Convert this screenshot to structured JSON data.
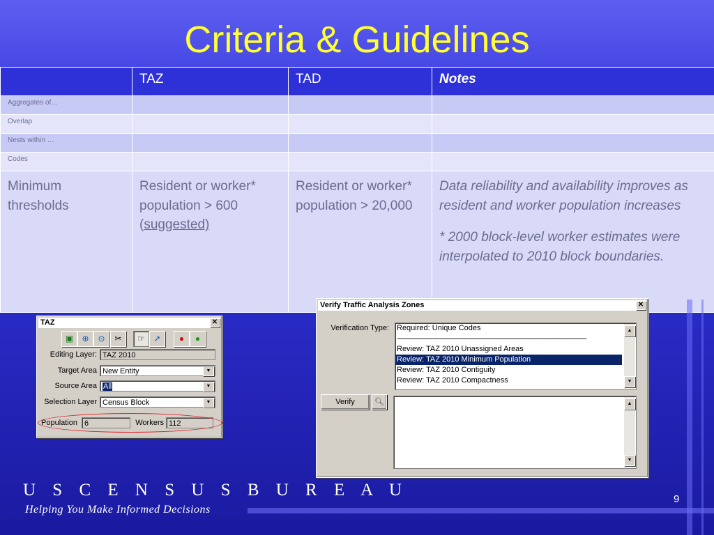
{
  "slide": {
    "title": "Criteria & Guidelines",
    "page_number": "9",
    "brand": "U S C E N S U S B U R E A U",
    "tagline": "Helping You Make Informed Decisions"
  },
  "criteria_table": {
    "headers": [
      "",
      "TAZ",
      "TAD",
      "Notes"
    ],
    "small_rows": [
      {
        "label": "Aggregates of…"
      },
      {
        "label": "Overlap"
      },
      {
        "label": "Nests within …"
      },
      {
        "label": "Codes"
      }
    ],
    "min_row": {
      "label": "Minimum thresholds",
      "taz_text": "Resident or worker* population > 600 (",
      "taz_suggested": "suggested)",
      "tad": "Resident or worker* population > 20,000",
      "notes_p1": " Data reliability and availability improves as resident and worker population increases",
      "notes_p2": "* 2000 block-level worker estimates were interpolated to 2010 block boundaries."
    }
  },
  "taz_window": {
    "title": "TAZ",
    "toolbar_icons": [
      "select-feature-icon",
      "zoom-in-icon",
      "zoom-extent-icon",
      "tools-icon",
      "edit-pointer-icon",
      "select-pointer-icon",
      "traffic-light-red-icon",
      "traffic-light-green-icon"
    ],
    "editing_layer_label": "Editing Layer:",
    "editing_layer_value": "TAZ 2010",
    "target_area_label": "Target Area",
    "target_area_value": "New Entity",
    "source_area_label": "Source Area",
    "source_area_value": "All",
    "selection_layer_label": "Selection Layer",
    "selection_layer_value": "Census Block",
    "population_label": "Population",
    "population_value": "6",
    "workers_label": "Workers",
    "workers_value": "112"
  },
  "verify_window": {
    "title": "Verify Traffic Analysis Zones",
    "verification_type_label": "Verification Type:",
    "items": [
      "Required: Unique Codes",
      "------------------------------------------------------------------------------------------------------",
      "Review: TAZ 2010 Unassigned Areas",
      "Review: TAZ 2010 Minimum Population",
      "Review: TAZ 2010 Contiguity",
      "Review: TAZ 2010 Compactness"
    ],
    "selected_item": "Review: TAZ 2010 Minimum Population",
    "verify_button": "Verify",
    "results_text": ""
  },
  "colors": {
    "title": "#ffff33",
    "table_header": "#2e31d8",
    "highlight": "#0a246a",
    "annotation_ellipse": "#e0202a"
  }
}
